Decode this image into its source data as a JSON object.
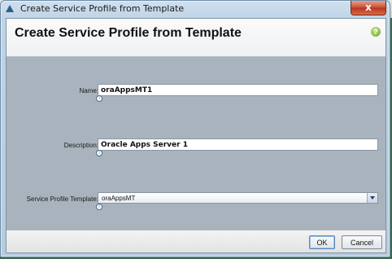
{
  "window": {
    "title": "Create Service Profile from Template",
    "close_glyph": "x"
  },
  "dialog": {
    "heading": "Create Service Profile from Template",
    "help_glyph": "?",
    "fields": {
      "name": {
        "label": "Name:",
        "value": "oraAppsMT1"
      },
      "description": {
        "label": "Description:",
        "value": "Oracle Apps Server 1"
      },
      "template": {
        "label": "Service Profile Template:",
        "value": "oraAppsMT"
      }
    },
    "info_glyph": "i"
  },
  "buttons": {
    "ok": "OK",
    "cancel": "Cancel"
  }
}
